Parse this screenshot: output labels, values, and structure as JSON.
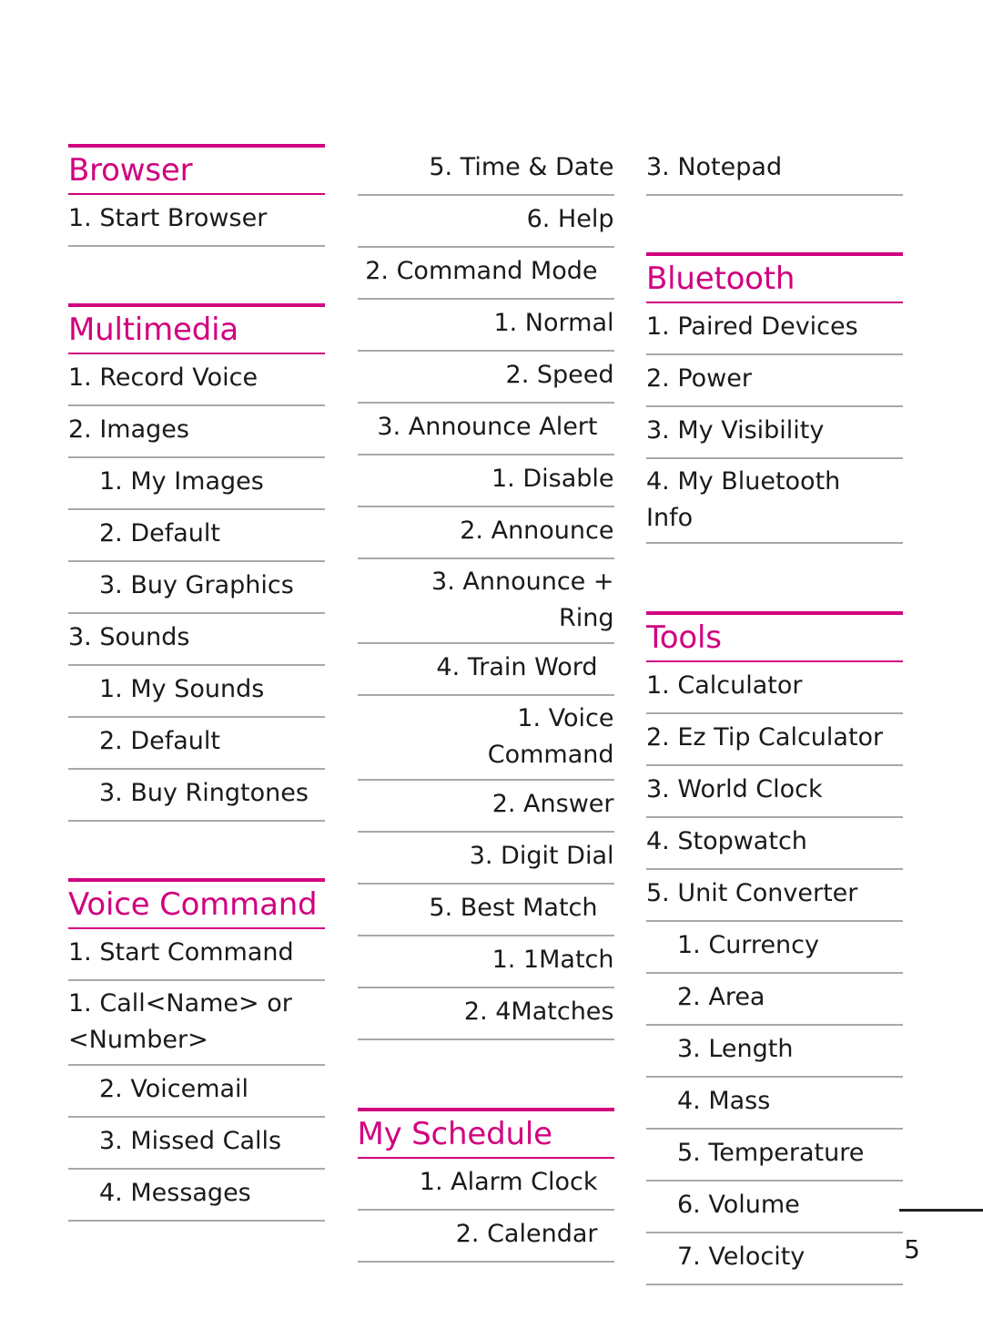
{
  "page": {
    "number": "5"
  },
  "columns": [
    {
      "name": "left",
      "blocks": [
        {
          "kind": "section",
          "title": "Browser",
          "items": [
            {
              "text": "1. Start Browser",
              "level": 1
            }
          ]
        },
        {
          "kind": "gap",
          "size": "md"
        },
        {
          "kind": "section",
          "title": "Multimedia",
          "items": [
            {
              "text": "1. Record Voice",
              "level": 1
            },
            {
              "text": "2. Images",
              "level": 1
            },
            {
              "text": "1. My Images",
              "level": 2
            },
            {
              "text": "2. Default",
              "level": 2
            },
            {
              "text": "3. Buy Graphics",
              "level": 2
            },
            {
              "text": "3. Sounds",
              "level": 1
            },
            {
              "text": "1. My Sounds",
              "level": 2
            },
            {
              "text": "2. Default",
              "level": 2
            },
            {
              "text": "3. Buy Ringtones",
              "level": 2
            }
          ]
        },
        {
          "kind": "gap",
          "size": "md"
        },
        {
          "kind": "section",
          "title": "Voice Command",
          "items": [
            {
              "text": "1. Start Command",
              "level": 1
            },
            {
              "text": "1. Call<Name> or\n<Number>",
              "level": 2,
              "lines": 2
            },
            {
              "text": "2. Voicemail",
              "level": 2
            },
            {
              "text": "3. Missed Calls",
              "level": 2
            },
            {
              "text": "4. Messages",
              "level": 2
            }
          ]
        }
      ]
    },
    {
      "name": "mid",
      "blocks": [
        {
          "kind": "list",
          "items": [
            {
              "text": "5. Time & Date",
              "level": 2
            },
            {
              "text": "6. Help",
              "level": 2
            },
            {
              "text": "2. Command Mode",
              "level": 1
            },
            {
              "text": "1. Normal",
              "level": 2
            },
            {
              "text": "2. Speed",
              "level": 2
            },
            {
              "text": "3. Announce Alert",
              "level": 1
            },
            {
              "text": "1. Disable",
              "level": 2
            },
            {
              "text": "2. Announce",
              "level": 2
            },
            {
              "text": "3. Announce +\nRing",
              "level": 2,
              "lines": 2
            },
            {
              "text": "4. Train Word",
              "level": 1
            },
            {
              "text": "1. Voice\nCommand",
              "level": 2,
              "lines": 2
            },
            {
              "text": "2. Answer",
              "level": 2
            },
            {
              "text": "3. Digit Dial",
              "level": 2
            },
            {
              "text": "5. Best Match",
              "level": 1
            },
            {
              "text": "1. 1Match",
              "level": 2
            },
            {
              "text": "2. 4Matches",
              "level": 2
            }
          ]
        },
        {
          "kind": "gap",
          "size": "lg"
        },
        {
          "kind": "section",
          "title": "My Schedule",
          "items": [
            {
              "text": "1. Alarm Clock",
              "level": 1
            },
            {
              "text": "2. Calendar",
              "level": 1
            }
          ]
        }
      ]
    },
    {
      "name": "right",
      "blocks": [
        {
          "kind": "list",
          "items": [
            {
              "text": "3. Notepad",
              "level": 1
            }
          ]
        },
        {
          "kind": "gap",
          "size": "md"
        },
        {
          "kind": "section",
          "title": "Bluetooth",
          "items": [
            {
              "text": "1. Paired Devices",
              "level": 1
            },
            {
              "text": "2. Power",
              "level": 1
            },
            {
              "text": "3. My Visibility",
              "level": 1
            },
            {
              "text": "4. My Bluetooth\nInfo",
              "level": 1,
              "lines": 2
            }
          ]
        },
        {
          "kind": "gap",
          "size": "lg"
        },
        {
          "kind": "section",
          "title": "Tools",
          "items": [
            {
              "text": "1. Calculator",
              "level": 1
            },
            {
              "text": "2. Ez Tip Calculator",
              "level": 1
            },
            {
              "text": "3. World Clock",
              "level": 1
            },
            {
              "text": "4. Stopwatch",
              "level": 1
            },
            {
              "text": "5. Unit Converter",
              "level": 1
            },
            {
              "text": "1. Currency",
              "level": 2
            },
            {
              "text": "2. Area",
              "level": 2
            },
            {
              "text": "3. Length",
              "level": 2
            },
            {
              "text": "4. Mass",
              "level": 2
            },
            {
              "text": "5. Temperature",
              "level": 2
            },
            {
              "text": "6. Volume",
              "level": 2
            },
            {
              "text": "7. Velocity",
              "level": 2
            }
          ]
        }
      ]
    }
  ]
}
